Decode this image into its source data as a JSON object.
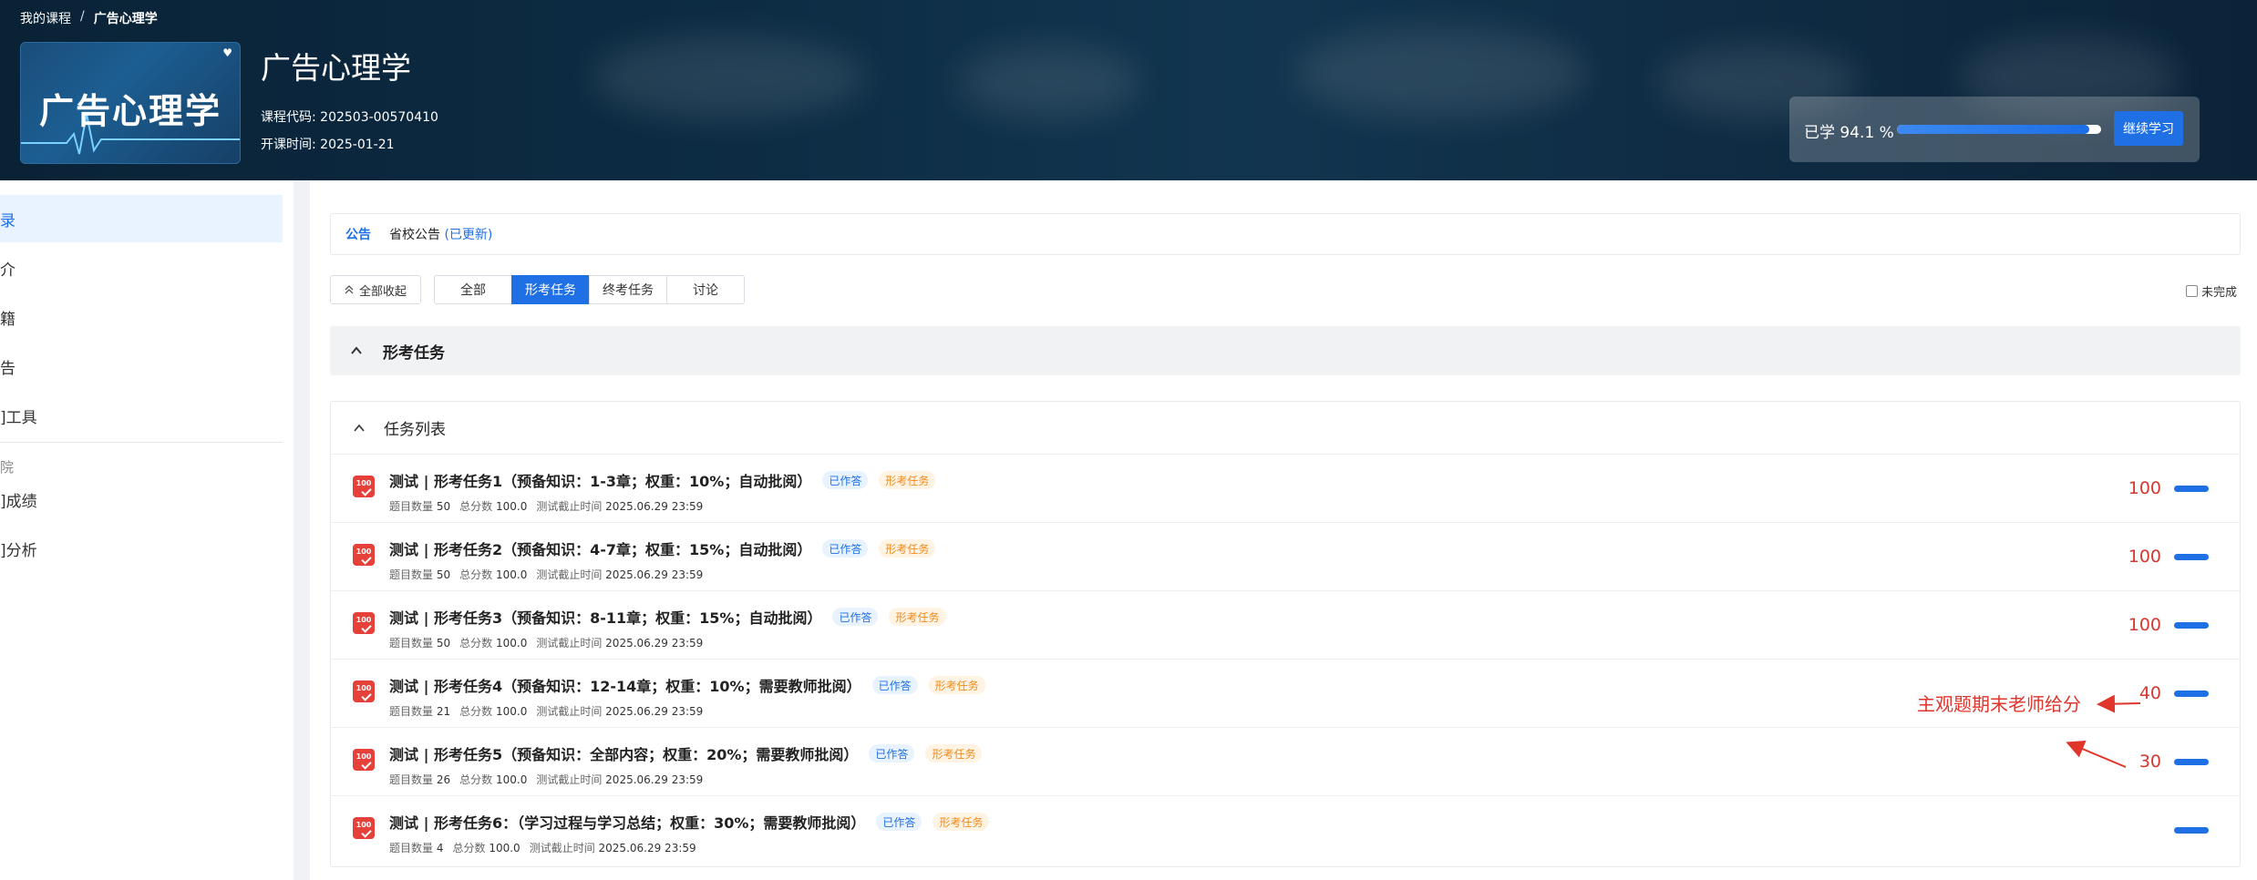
{
  "breadcrumb": {
    "root": "我的课程",
    "separator": "/",
    "current": "广告心理学"
  },
  "course": {
    "cover_text": "广告心理学",
    "title": "广告心理学",
    "code_line": "课程代码: 202503-00570410",
    "date_line": "开课时间: 2025-01-21"
  },
  "progress": {
    "label": "已学 94.1 %",
    "percent": 94.1,
    "button": "继续学习"
  },
  "sidebar": {
    "items": [
      {
        "label": "录",
        "active": true
      },
      {
        "label": "介",
        "active": false
      },
      {
        "label": "籍",
        "active": false
      },
      {
        "label": "告",
        "active": false
      },
      {
        "label": "]工具",
        "active": false
      }
    ],
    "group": "院",
    "group_items": [
      "]成绩",
      "]分析"
    ]
  },
  "notice": {
    "label": "公告",
    "text": "省校公告",
    "link": "(已更新)"
  },
  "toolbar": {
    "collapse_all": "全部收起",
    "tabs": [
      {
        "label": "全部",
        "active": false
      },
      {
        "label": "形考任务",
        "active": true
      },
      {
        "label": "终考任务",
        "active": false
      },
      {
        "label": "讨论",
        "active": false
      }
    ],
    "unfinished": "未完成"
  },
  "section": {
    "title": "形考任务"
  },
  "tasklist": {
    "title": "任务列表",
    "meta_labels": {
      "count": "题目数量",
      "total": "总分数",
      "deadline": "测试截止时间"
    },
    "tasks": [
      {
        "title": "测试 | 形考任务1（预备知识：1-3章；权重：10%；自动批阅）",
        "status": "已作答",
        "kind": "形考任务",
        "count": "50",
        "total": "100.0",
        "deadline": "2025.06.29 23:59",
        "score": "100"
      },
      {
        "title": "测试 | 形考任务2（预备知识：4-7章；权重：15%；自动批阅）",
        "status": "已作答",
        "kind": "形考任务",
        "count": "50",
        "total": "100.0",
        "deadline": "2025.06.29 23:59",
        "score": "100"
      },
      {
        "title": "测试 | 形考任务3（预备知识：8-11章；权重：15%；自动批阅）",
        "status": "已作答",
        "kind": "形考任务",
        "count": "50",
        "total": "100.0",
        "deadline": "2025.06.29 23:59",
        "score": "100"
      },
      {
        "title": "测试 | 形考任务4（预备知识：12-14章；权重：10%；需要教师批阅）",
        "status": "已作答",
        "kind": "形考任务",
        "count": "21",
        "total": "100.0",
        "deadline": "2025.06.29 23:59",
        "score": "40"
      },
      {
        "title": "测试 | 形考任务5（预备知识：全部内容；权重：20%；需要教师批阅）",
        "status": "已作答",
        "kind": "形考任务",
        "count": "26",
        "total": "100.0",
        "deadline": "2025.06.29 23:59",
        "score": "30"
      },
      {
        "title": "测试 | 形考任务6：（学习过程与学习总结；权重：30%；需要教师批阅）",
        "status": "已作答",
        "kind": "形考任务",
        "count": "4",
        "total": "100.0",
        "deadline": "2025.06.29 23:59",
        "score": ""
      }
    ]
  },
  "annotation": {
    "text": "主观题期末老师给分",
    "color": "#e0352b"
  },
  "colors": {
    "accent": "#1f6fe5",
    "score": "#d6382f",
    "tag_orange": "#ef8a1a"
  }
}
